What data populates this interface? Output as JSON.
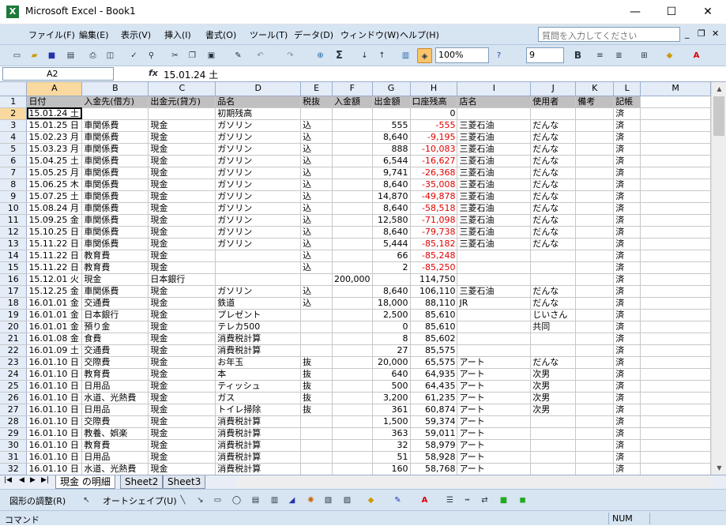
{
  "window": {
    "title": "Microsoft Excel - Book1",
    "app_icon": "X",
    "minimize": "—",
    "maximize": "☐",
    "close": "✕"
  },
  "menubar": {
    "items": [
      "ファイル(F)",
      "編集(E)",
      "表示(V)",
      "挿入(I)",
      "書式(O)",
      "ツール(T)",
      "データ(D)",
      "ウィンドウ(W)",
      "ヘルプ(H)"
    ],
    "help_placeholder": "質問を入力してください",
    "doc_minimize": "_",
    "doc_restore": "❐",
    "doc_close": "✕"
  },
  "toolbar": {
    "zoom": "100%",
    "font_size": "9",
    "bold": "B",
    "sigma": "Σ"
  },
  "formula_bar": {
    "name_box": "A2",
    "fx_label": "fx",
    "value": "15.01.24 土"
  },
  "columns": [
    "A",
    "B",
    "C",
    "D",
    "E",
    "F",
    "G",
    "H",
    "I",
    "J",
    "K",
    "L",
    "M"
  ],
  "row_numbers": [
    "1",
    "2",
    "3",
    "4",
    "5",
    "6",
    "7",
    "8",
    "9",
    "10",
    "11",
    "12",
    "13",
    "14",
    "15",
    "16",
    "17",
    "18",
    "19",
    "20",
    "21",
    "22",
    "23",
    "24",
    "25",
    "26",
    "27",
    "28",
    "29",
    "30",
    "31",
    "32"
  ],
  "header_row": [
    "日付",
    "入金先(借方)",
    "出金元(貸方)",
    "品名",
    "税抜",
    "入金額",
    "出金額",
    "口座残高",
    "店名",
    "使用者",
    "備考",
    "記帳",
    ""
  ],
  "rows": [
    [
      "15.01.24 土",
      "",
      "",
      "初期残高",
      "",
      "",
      "",
      "0",
      "",
      "",
      "",
      "済",
      ""
    ],
    [
      "15.01.25 日",
      "車関係費",
      "現金",
      "ガソリン",
      "込",
      "",
      "555",
      "-555",
      "三菱石油",
      "だんな",
      "",
      "済",
      ""
    ],
    [
      "15.02.23 月",
      "車関係費",
      "現金",
      "ガソリン",
      "込",
      "",
      "8,640",
      "-9,195",
      "三菱石油",
      "だんな",
      "",
      "済",
      ""
    ],
    [
      "15.03.23 月",
      "車関係費",
      "現金",
      "ガソリン",
      "込",
      "",
      "888",
      "-10,083",
      "三菱石油",
      "だんな",
      "",
      "済",
      ""
    ],
    [
      "15.04.25 土",
      "車関係費",
      "現金",
      "ガソリン",
      "込",
      "",
      "6,544",
      "-16,627",
      "三菱石油",
      "だんな",
      "",
      "済",
      ""
    ],
    [
      "15.05.25 月",
      "車関係費",
      "現金",
      "ガソリン",
      "込",
      "",
      "9,741",
      "-26,368",
      "三菱石油",
      "だんな",
      "",
      "済",
      ""
    ],
    [
      "15.06.25 木",
      "車関係費",
      "現金",
      "ガソリン",
      "込",
      "",
      "8,640",
      "-35,008",
      "三菱石油",
      "だんな",
      "",
      "済",
      ""
    ],
    [
      "15.07.25 土",
      "車関係費",
      "現金",
      "ガソリン",
      "込",
      "",
      "14,870",
      "-49,878",
      "三菱石油",
      "だんな",
      "",
      "済",
      ""
    ],
    [
      "15.08.24 月",
      "車関係費",
      "現金",
      "ガソリン",
      "込",
      "",
      "8,640",
      "-58,518",
      "三菱石油",
      "だんな",
      "",
      "済",
      ""
    ],
    [
      "15.09.25 金",
      "車関係費",
      "現金",
      "ガソリン",
      "込",
      "",
      "12,580",
      "-71,098",
      "三菱石油",
      "だんな",
      "",
      "済",
      ""
    ],
    [
      "15.10.25 日",
      "車関係費",
      "現金",
      "ガソリン",
      "込",
      "",
      "8,640",
      "-79,738",
      "三菱石油",
      "だんな",
      "",
      "済",
      ""
    ],
    [
      "15.11.22 日",
      "車関係費",
      "現金",
      "ガソリン",
      "込",
      "",
      "5,444",
      "-85,182",
      "三菱石油",
      "だんな",
      "",
      "済",
      ""
    ],
    [
      "15.11.22 日",
      "教育費",
      "現金",
      "",
      "込",
      "",
      "66",
      "-85,248",
      "",
      "",
      "",
      "済",
      ""
    ],
    [
      "15.11.22 日",
      "教育費",
      "現金",
      "",
      "込",
      "",
      "2",
      "-85,250",
      "",
      "",
      "",
      "済",
      ""
    ],
    [
      "15.12.01 火",
      "現金",
      "日本銀行",
      "",
      "",
      "200,000",
      "",
      "114,750",
      "",
      "",
      "",
      "済",
      ""
    ],
    [
      "15.12.25 金",
      "車関係費",
      "現金",
      "ガソリン",
      "込",
      "",
      "8,640",
      "106,110",
      "三菱石油",
      "だんな",
      "",
      "済",
      ""
    ],
    [
      "16.01.01 金",
      "交通費",
      "現金",
      "鉄道",
      "込",
      "",
      "18,000",
      "88,110",
      "JR",
      "だんな",
      "",
      "済",
      ""
    ],
    [
      "16.01.01 金",
      "日本銀行",
      "現金",
      "プレゼント",
      "",
      "",
      "2,500",
      "85,610",
      "",
      "じいさん",
      "",
      "済",
      ""
    ],
    [
      "16.01.01 金",
      "預り金",
      "現金",
      "テレカ500",
      "",
      "",
      "0",
      "85,610",
      "",
      "共同",
      "",
      "済",
      ""
    ],
    [
      "16.01.08 金",
      "食費",
      "現金",
      "消費税計算",
      "",
      "",
      "8",
      "85,602",
      "",
      "",
      "",
      "済",
      ""
    ],
    [
      "16.01.09 土",
      "交通費",
      "現金",
      "消費税計算",
      "",
      "",
      "27",
      "85,575",
      "",
      "",
      "",
      "済",
      ""
    ],
    [
      "16.01.10 日",
      "交際費",
      "現金",
      "お年玉",
      "抜",
      "",
      "20,000",
      "65,575",
      "アート",
      "だんな",
      "",
      "済",
      ""
    ],
    [
      "16.01.10 日",
      "教育費",
      "現金",
      "本",
      "抜",
      "",
      "640",
      "64,935",
      "アート",
      "次男",
      "",
      "済",
      ""
    ],
    [
      "16.01.10 日",
      "日用品",
      "現金",
      "ティッシュ",
      "抜",
      "",
      "500",
      "64,435",
      "アート",
      "次男",
      "",
      "済",
      ""
    ],
    [
      "16.01.10 日",
      "水道、光熱費",
      "現金",
      "ガス",
      "抜",
      "",
      "3,200",
      "61,235",
      "アート",
      "次男",
      "",
      "済",
      ""
    ],
    [
      "16.01.10 日",
      "日用品",
      "現金",
      "トイレ掃除",
      "抜",
      "",
      "361",
      "60,874",
      "アート",
      "次男",
      "",
      "済",
      ""
    ],
    [
      "16.01.10 日",
      "交際費",
      "現金",
      "消費税計算",
      "",
      "",
      "1,500",
      "59,374",
      "アート",
      "",
      "",
      "済",
      ""
    ],
    [
      "16.01.10 日",
      "教養、娯楽",
      "現金",
      "消費税計算",
      "",
      "",
      "363",
      "59,011",
      "アート",
      "",
      "",
      "済",
      ""
    ],
    [
      "16.01.10 日",
      "教育費",
      "現金",
      "消費税計算",
      "",
      "",
      "32",
      "58,979",
      "アート",
      "",
      "",
      "済",
      ""
    ],
    [
      "16.01.10 日",
      "日用品",
      "現金",
      "消費税計算",
      "",
      "",
      "51",
      "58,928",
      "アート",
      "",
      "",
      "済",
      ""
    ],
    [
      "16.01.10 日",
      "水道、光熱費",
      "現金",
      "消費税計算",
      "",
      "",
      "160",
      "58,768",
      "アート",
      "",
      "",
      "済",
      ""
    ]
  ],
  "sheet_tabs": [
    "現金 の明細",
    "Sheet2",
    "Sheet3"
  ],
  "drawing_bar": {
    "adjust": "図形の調整(R)",
    "autoshape": "オートシェイプ(U)"
  },
  "status": {
    "mode": "コマンド",
    "num": "NUM"
  },
  "colors": {
    "negative": "#e00000",
    "header_fill": "#c0c0c0",
    "active_header": "#f9d99f"
  }
}
